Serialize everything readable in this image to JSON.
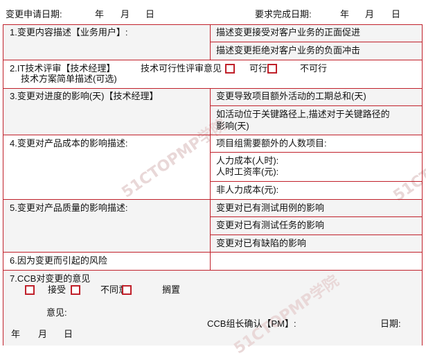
{
  "header": {
    "apply_date_label": "变更申请日期:",
    "apply_year": "年",
    "apply_month": "月",
    "apply_day": "日",
    "complete_date_label": "要求完成日期:",
    "complete_year": "年",
    "complete_month": "月",
    "complete_day": "日"
  },
  "sections": {
    "s1": {
      "title": "1.变更内容描述【业务用户】:",
      "right": [
        "描述变更接受对客户业务的正面促进",
        "描述变更拒绝对客户业务的负面冲击"
      ]
    },
    "s2": {
      "title": "2.IT技术评审【技术经理】",
      "opinion_label": "技术可行性评审意见",
      "feasible": "可行",
      "infeasible": "不可行",
      "subtitle": "技术方案简单描述(可选)"
    },
    "s3": {
      "title": "3.变更对进度的影响(天)【技术经理】",
      "right": [
        "变更导致项目额外活动的工期总和(天)",
        "如活动位于关键路径上,描述对于关键路径的",
        "影响(天)"
      ]
    },
    "s4": {
      "title": "4.变更对产品成本的影响描述:",
      "right": [
        "项目组需要额外的人数项目:",
        "人力成本(人时):",
        "人时工资率(元):",
        "非人力成本(元):"
      ]
    },
    "s5": {
      "title": "5.变更对产品质量的影响描述:",
      "right": [
        "变更对已有测试用例的影响",
        "变更对已有测试任务的影响",
        "变更对已有缺陷的影响"
      ]
    },
    "s6": {
      "title": "6.因为变更而引起的风险"
    },
    "s7": {
      "title": "7.CCB对变更的意见",
      "accept": "接受",
      "disagree": "不同意",
      "shelve": "搁置",
      "opinion_label": "意见:",
      "ccb_confirm": "CCB组长确认【PM】:",
      "date_label": "日期:",
      "year": "年",
      "month": "月",
      "day": "日"
    }
  },
  "watermark": "51CTOPMP学院",
  "colors": {
    "border": "#c0202a",
    "checkbox": "#c0202a",
    "shade": "#f4f4f4"
  }
}
